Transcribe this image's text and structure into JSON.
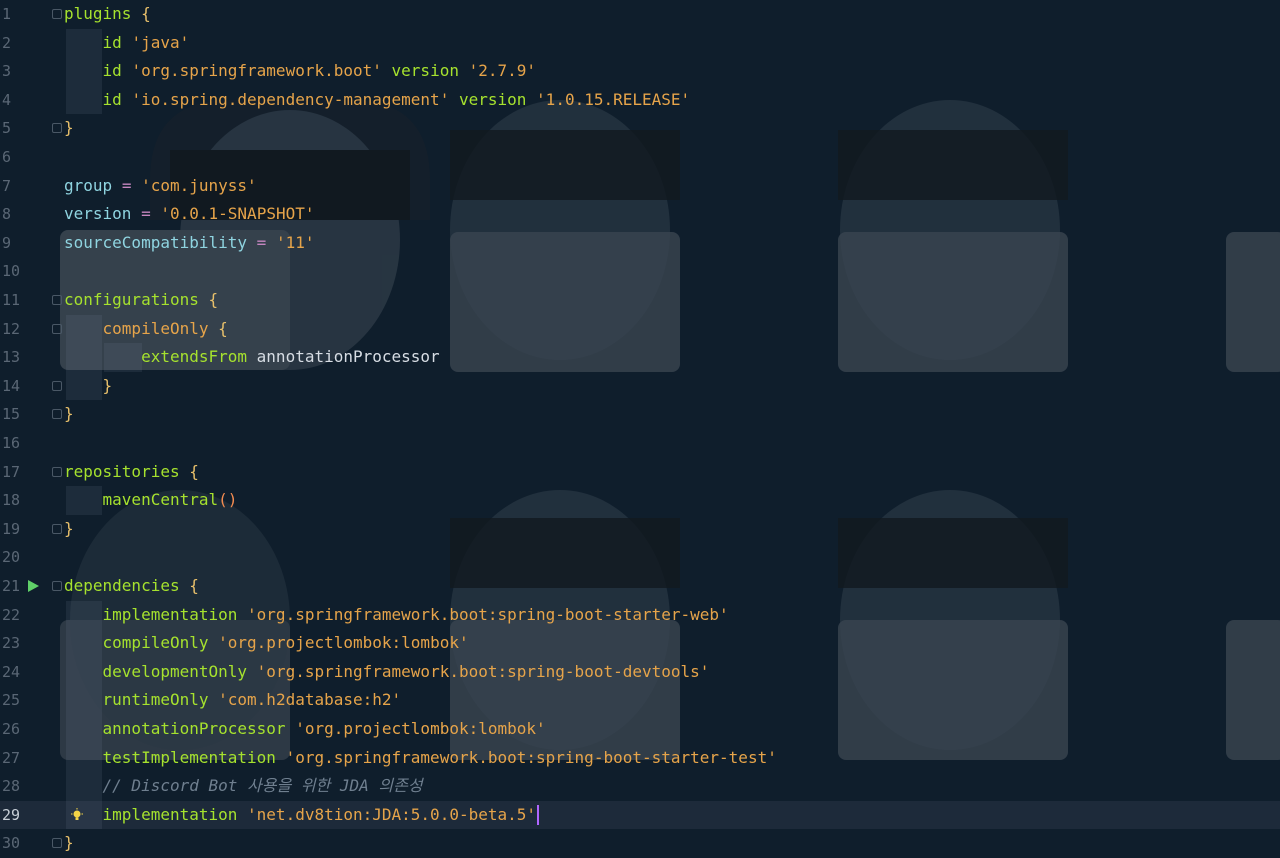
{
  "editor": {
    "current_line": 29,
    "lines": [
      {
        "n": "1",
        "tokens": [
          [
            "kw",
            "plugins"
          ],
          [
            "plain",
            " "
          ],
          [
            "brace",
            "{"
          ]
        ]
      },
      {
        "n": "2",
        "tokens": [
          [
            "plain",
            "    "
          ],
          [
            "kw",
            "id"
          ],
          [
            "plain",
            " "
          ],
          [
            "str",
            "'java'"
          ]
        ]
      },
      {
        "n": "3",
        "tokens": [
          [
            "plain",
            "    "
          ],
          [
            "kw",
            "id"
          ],
          [
            "plain",
            " "
          ],
          [
            "str",
            "'org.springframework.boot'"
          ],
          [
            "plain",
            " "
          ],
          [
            "kw",
            "version"
          ],
          [
            "plain",
            " "
          ],
          [
            "str",
            "'2.7.9'"
          ]
        ]
      },
      {
        "n": "4",
        "tokens": [
          [
            "plain",
            "    "
          ],
          [
            "kw",
            "id"
          ],
          [
            "plain",
            " "
          ],
          [
            "str",
            "'io.spring.dependency-management'"
          ],
          [
            "plain",
            " "
          ],
          [
            "kw",
            "version"
          ],
          [
            "plain",
            " "
          ],
          [
            "str",
            "'1.0.15.RELEASE'"
          ]
        ]
      },
      {
        "n": "5",
        "tokens": [
          [
            "brace",
            "}"
          ]
        ]
      },
      {
        "n": "6",
        "tokens": []
      },
      {
        "n": "7",
        "tokens": [
          [
            "prop",
            "group"
          ],
          [
            "plain",
            " "
          ],
          [
            "op",
            "="
          ],
          [
            "plain",
            " "
          ],
          [
            "str",
            "'com.junyss'"
          ]
        ]
      },
      {
        "n": "8",
        "tokens": [
          [
            "prop",
            "version"
          ],
          [
            "plain",
            " "
          ],
          [
            "op",
            "="
          ],
          [
            "plain",
            " "
          ],
          [
            "str",
            "'0.0.1-SNAPSHOT'"
          ]
        ]
      },
      {
        "n": "9",
        "tokens": [
          [
            "prop",
            "sourceCompatibility"
          ],
          [
            "plain",
            " "
          ],
          [
            "op",
            "="
          ],
          [
            "plain",
            " "
          ],
          [
            "str",
            "'11'"
          ]
        ]
      },
      {
        "n": "10",
        "tokens": []
      },
      {
        "n": "11",
        "tokens": [
          [
            "kw",
            "configurations"
          ],
          [
            "plain",
            " "
          ],
          [
            "brace",
            "{"
          ]
        ]
      },
      {
        "n": "12",
        "tokens": [
          [
            "plain",
            "    "
          ],
          [
            "str",
            "compileOnly"
          ],
          [
            "plain",
            " "
          ],
          [
            "brace",
            "{"
          ]
        ]
      },
      {
        "n": "13",
        "tokens": [
          [
            "plain",
            "        "
          ],
          [
            "kw",
            "extendsFrom"
          ],
          [
            "plain",
            " annotationProcessor"
          ]
        ]
      },
      {
        "n": "14",
        "tokens": [
          [
            "plain",
            "    "
          ],
          [
            "brace",
            "}"
          ]
        ]
      },
      {
        "n": "15",
        "tokens": [
          [
            "brace",
            "}"
          ]
        ]
      },
      {
        "n": "16",
        "tokens": []
      },
      {
        "n": "17",
        "tokens": [
          [
            "kw",
            "repositories"
          ],
          [
            "plain",
            " "
          ],
          [
            "brace",
            "{"
          ]
        ]
      },
      {
        "n": "18",
        "tokens": [
          [
            "plain",
            "    "
          ],
          [
            "fn",
            "mavenCentral"
          ],
          [
            "paren",
            "()"
          ]
        ]
      },
      {
        "n": "19",
        "tokens": [
          [
            "brace",
            "}"
          ]
        ]
      },
      {
        "n": "20",
        "tokens": []
      },
      {
        "n": "21",
        "tokens": [
          [
            "kw",
            "dependencies"
          ],
          [
            "plain",
            " "
          ],
          [
            "brace",
            "{"
          ]
        ]
      },
      {
        "n": "22",
        "tokens": [
          [
            "plain",
            "    "
          ],
          [
            "kw",
            "implementation"
          ],
          [
            "plain",
            " "
          ],
          [
            "str",
            "'org.springframework.boot:spring-boot-starter-web'"
          ]
        ]
      },
      {
        "n": "23",
        "tokens": [
          [
            "plain",
            "    "
          ],
          [
            "kw",
            "compileOnly"
          ],
          [
            "plain",
            " "
          ],
          [
            "str",
            "'org.projectlombok:lombok'"
          ]
        ]
      },
      {
        "n": "24",
        "tokens": [
          [
            "plain",
            "    "
          ],
          [
            "kw",
            "developmentOnly"
          ],
          [
            "plain",
            " "
          ],
          [
            "str",
            "'org.springframework.boot:spring-boot-devtools'"
          ]
        ]
      },
      {
        "n": "25",
        "tokens": [
          [
            "plain",
            "    "
          ],
          [
            "kw",
            "runtimeOnly"
          ],
          [
            "plain",
            " "
          ],
          [
            "str",
            "'com.h2database:h2'"
          ]
        ]
      },
      {
        "n": "26",
        "tokens": [
          [
            "plain",
            "    "
          ],
          [
            "kw",
            "annotationProcessor"
          ],
          [
            "plain",
            " "
          ],
          [
            "str",
            "'org.projectlombok:lombok'"
          ]
        ]
      },
      {
        "n": "27",
        "tokens": [
          [
            "plain",
            "    "
          ],
          [
            "kw",
            "testImplementation"
          ],
          [
            "plain",
            " "
          ],
          [
            "str",
            "'org.springframework.boot:spring-boot-starter-test'"
          ]
        ]
      },
      {
        "n": "28",
        "tokens": [
          [
            "plain",
            "    "
          ],
          [
            "comment",
            "// Discord Bot 사용을 위한 JDA 의존성"
          ]
        ]
      },
      {
        "n": "29",
        "tokens": [
          [
            "plain",
            "    "
          ],
          [
            "kw",
            "implementation"
          ],
          [
            "plain",
            " "
          ],
          [
            "str",
            "'net.dv8tion:JDA:5.0.0-beta.5'"
          ]
        ]
      },
      {
        "n": "30",
        "tokens": [
          [
            "brace",
            "}"
          ]
        ]
      }
    ],
    "fold_lines": [
      1,
      5,
      11,
      12,
      14,
      15,
      17,
      19,
      21,
      30
    ],
    "guide1_lines": [
      2,
      3,
      4,
      12,
      13,
      14,
      18,
      22,
      23,
      24,
      25,
      26,
      27,
      28,
      29
    ],
    "guide2_lines": [
      13
    ],
    "run_line": 21,
    "hint_line": 29,
    "icons": {
      "run": "run-gutter-icon",
      "hint": "lightbulb-icon"
    }
  }
}
